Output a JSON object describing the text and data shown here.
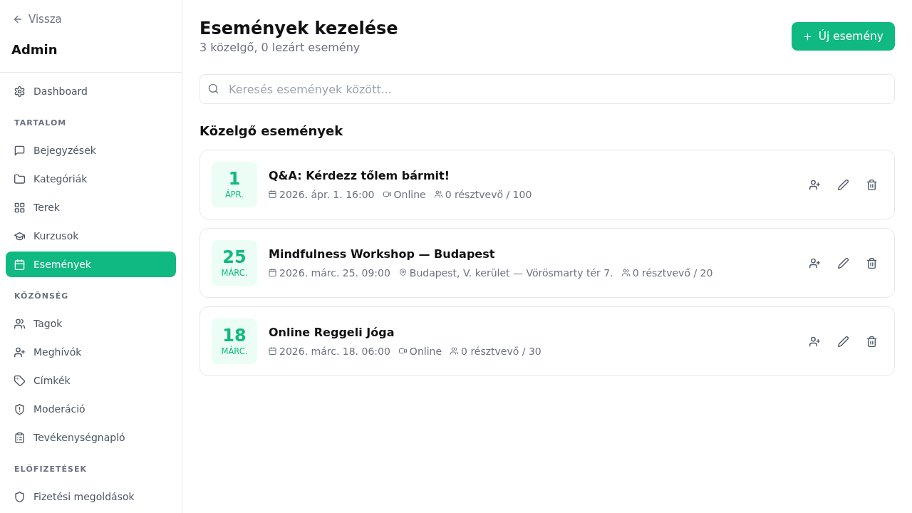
{
  "sidebar": {
    "back_link": "Vissza",
    "title": "Admin",
    "groups": [
      {
        "items": [
          {
            "label": "Dashboard",
            "selected": false
          }
        ]
      },
      {
        "heading": "TARTALOM",
        "items": [
          {
            "label": "Bejegyzések",
            "selected": false
          },
          {
            "label": "Kategóriák",
            "selected": false
          },
          {
            "label": "Terek",
            "selected": false
          },
          {
            "label": "Kurzusok",
            "selected": false
          },
          {
            "label": "Események",
            "selected": true
          }
        ]
      },
      {
        "heading": "KÖZÖNSÉG",
        "items": [
          {
            "label": "Tagok",
            "selected": false
          },
          {
            "label": "Meghívók",
            "selected": false
          },
          {
            "label": "Címkék",
            "selected": false
          },
          {
            "label": "Moderáció",
            "selected": false
          },
          {
            "label": "Tevékenységnapló",
            "selected": false
          }
        ]
      },
      {
        "heading": "ELŐFIZETÉSEK",
        "items": [
          {
            "label": "Fizetési megoldások",
            "selected": false
          }
        ]
      }
    ]
  },
  "header": {
    "title": "Események kezelése",
    "subtitle": "3 közelgő, 0 lezárt esemény",
    "new_button": "Új esemény"
  },
  "search": {
    "placeholder": "Keresés események között..."
  },
  "section_title": "Közelgő események",
  "events": [
    {
      "day": "1",
      "month": "ÁPR.",
      "title": "Q&A: Kérdezz tőlem bármit!",
      "meta": [
        {
          "kind": "datetime",
          "text": "2026. ápr. 1. 16:00"
        },
        {
          "kind": "online",
          "text": "Online"
        },
        {
          "kind": "attendees",
          "text": "0 résztvevő / 100"
        }
      ]
    },
    {
      "day": "25",
      "month": "MÁRC.",
      "title": "Mindfulness Workshop — Budapest",
      "meta": [
        {
          "kind": "datetime",
          "text": "2026. márc. 25. 09:00"
        },
        {
          "kind": "venue",
          "text": "Budapest, V. kerület — Vörösmarty tér 7."
        },
        {
          "kind": "attendees",
          "text": "0 résztvevő / 20"
        }
      ]
    },
    {
      "day": "18",
      "month": "MÁRC.",
      "title": "Online Reggeli Jóga",
      "meta": [
        {
          "kind": "datetime",
          "text": "2026. márc. 18. 06:00"
        },
        {
          "kind": "online",
          "text": "Online"
        },
        {
          "kind": "attendees",
          "text": "0 résztvevő / 30"
        }
      ]
    }
  ]
}
